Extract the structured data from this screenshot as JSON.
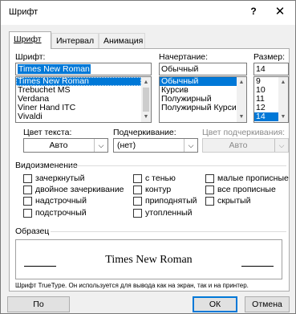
{
  "window": {
    "title": "Шрифт",
    "help": "?",
    "close": "✕"
  },
  "tabs": [
    {
      "label": "Шрифт"
    },
    {
      "label": "Интервал"
    },
    {
      "label": "Анимация"
    }
  ],
  "font": {
    "label": "Шрифт:",
    "value": "Times New Roman",
    "items": [
      "Times New Roman",
      "Trebuchet MS",
      "Verdana",
      "Viner Hand ITC",
      "Vivaldi"
    ]
  },
  "style": {
    "label": "Начертание:",
    "value": "Обычный",
    "items": [
      "Обычный",
      "Курсив",
      "Полужирный",
      "Полужирный Курсив"
    ]
  },
  "size": {
    "label": "Размер:",
    "value": "14",
    "items": [
      "9",
      "10",
      "11",
      "12",
      "14"
    ]
  },
  "text_color": {
    "label": "Цвет текста:",
    "value": "Авто"
  },
  "underline": {
    "label": "Подчеркивание:",
    "value": "(нет)"
  },
  "underline_color": {
    "label": "Цвет подчеркивания:",
    "value": "Авто"
  },
  "effects": {
    "label": "Видоизменение",
    "items": [
      "зачеркнутый",
      "двойное зачеркивание",
      "надстрочный",
      "подстрочный",
      "с тенью",
      "контур",
      "приподнятый",
      "утопленный",
      "малые прописные",
      "все прописные",
      "скрытый"
    ]
  },
  "sample": {
    "label": "Образец",
    "text": "Times New Roman",
    "note": "Шрифт TrueType. Он используется для вывода как на экран, так и на принтер."
  },
  "buttons": {
    "default": "По умолчанию...",
    "ok": "ОК",
    "cancel": "Отмена"
  },
  "colors": {
    "accent": "#0078d7"
  }
}
